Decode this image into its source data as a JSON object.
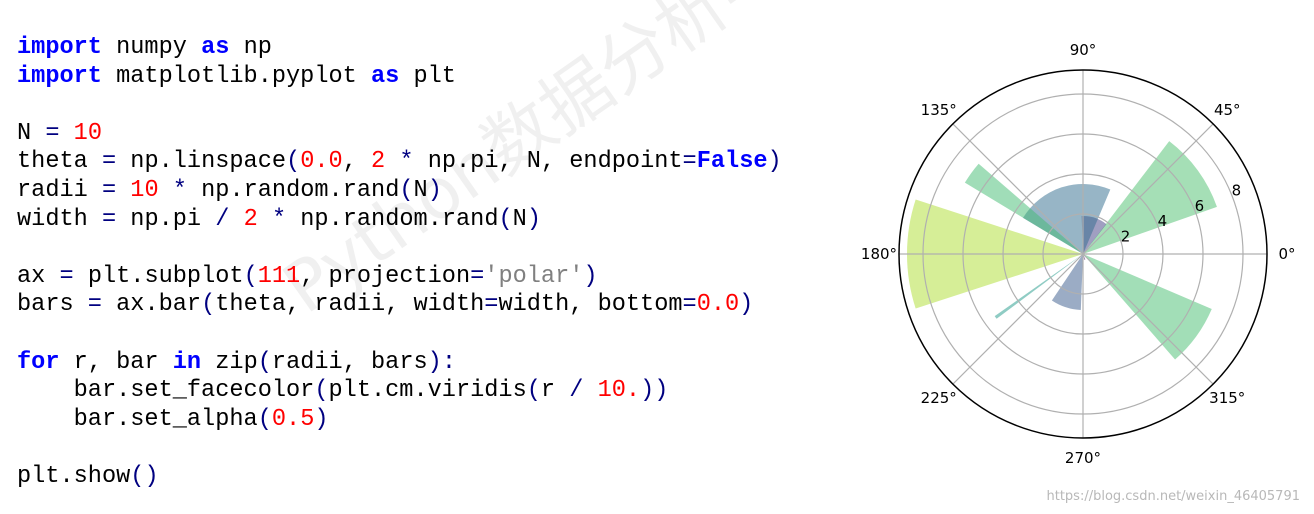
{
  "code": {
    "lines": [
      [
        [
          "kw",
          "import"
        ],
        [
          "plain",
          " numpy "
        ],
        [
          "kw",
          "as"
        ],
        [
          "plain",
          " np"
        ]
      ],
      [
        [
          "kw",
          "import"
        ],
        [
          "plain",
          " matplotlib.pyplot "
        ],
        [
          "kw",
          "as"
        ],
        [
          "plain",
          " plt"
        ]
      ],
      [],
      [
        [
          "plain",
          "N "
        ],
        [
          "op",
          "="
        ],
        [
          "plain",
          " "
        ],
        [
          "num",
          "10"
        ]
      ],
      [
        [
          "plain",
          "theta "
        ],
        [
          "op",
          "="
        ],
        [
          "plain",
          " np.linspace"
        ],
        [
          "op",
          "("
        ],
        [
          "num",
          "0.0"
        ],
        [
          "plain",
          ", "
        ],
        [
          "num",
          "2"
        ],
        [
          "plain",
          " "
        ],
        [
          "op",
          "*"
        ],
        [
          "plain",
          " np.pi, N, endpoint"
        ],
        [
          "op",
          "="
        ],
        [
          "const",
          "False"
        ],
        [
          "op",
          ")"
        ]
      ],
      [
        [
          "plain",
          "radii "
        ],
        [
          "op",
          "="
        ],
        [
          "plain",
          " "
        ],
        [
          "num",
          "10"
        ],
        [
          "plain",
          " "
        ],
        [
          "op",
          "*"
        ],
        [
          "plain",
          " np.random.rand"
        ],
        [
          "op",
          "("
        ],
        [
          "plain",
          "N"
        ],
        [
          "op",
          ")"
        ]
      ],
      [
        [
          "plain",
          "width "
        ],
        [
          "op",
          "="
        ],
        [
          "plain",
          " np.pi "
        ],
        [
          "op",
          "/"
        ],
        [
          "plain",
          " "
        ],
        [
          "num",
          "2"
        ],
        [
          "plain",
          " "
        ],
        [
          "op",
          "*"
        ],
        [
          "plain",
          " np.random.rand"
        ],
        [
          "op",
          "("
        ],
        [
          "plain",
          "N"
        ],
        [
          "op",
          ")"
        ]
      ],
      [],
      [
        [
          "plain",
          "ax "
        ],
        [
          "op",
          "="
        ],
        [
          "plain",
          " plt.subplot"
        ],
        [
          "op",
          "("
        ],
        [
          "num",
          "111"
        ],
        [
          "plain",
          ", projection"
        ],
        [
          "op",
          "="
        ],
        [
          "str",
          "'polar'"
        ],
        [
          "op",
          ")"
        ]
      ],
      [
        [
          "plain",
          "bars "
        ],
        [
          "op",
          "="
        ],
        [
          "plain",
          " ax.bar"
        ],
        [
          "op",
          "("
        ],
        [
          "plain",
          "theta, radii, width"
        ],
        [
          "op",
          "="
        ],
        [
          "plain",
          "width, bottom"
        ],
        [
          "op",
          "="
        ],
        [
          "num",
          "0.0"
        ],
        [
          "op",
          ")"
        ]
      ],
      [],
      [
        [
          "kw",
          "for"
        ],
        [
          "plain",
          " r, bar "
        ],
        [
          "kw",
          "in"
        ],
        [
          "plain",
          " zip"
        ],
        [
          "op",
          "("
        ],
        [
          "plain",
          "radii, bars"
        ],
        [
          "op",
          "):"
        ]
      ],
      [
        [
          "plain",
          "    bar.set_facecolor"
        ],
        [
          "op",
          "("
        ],
        [
          "plain",
          "plt.cm.viridis"
        ],
        [
          "op",
          "("
        ],
        [
          "plain",
          "r "
        ],
        [
          "op",
          "/"
        ],
        [
          "plain",
          " "
        ],
        [
          "num",
          "10."
        ],
        [
          "op",
          "))"
        ]
      ],
      [
        [
          "plain",
          "    bar.set_alpha"
        ],
        [
          "op",
          "("
        ],
        [
          "num",
          "0.5"
        ],
        [
          "op",
          ")"
        ]
      ],
      [],
      [
        [
          "plain",
          "plt.show"
        ],
        [
          "op",
          "()"
        ]
      ]
    ]
  },
  "watermark": "Python数据分析与展示",
  "source_url": "https://blog.csdn.net/weixin_46405791",
  "chart_data": {
    "type": "bar",
    "projection": "polar",
    "colormap": "viridis",
    "alpha": 0.5,
    "theta_deg": [
      0,
      36,
      72,
      108,
      144,
      180,
      216,
      252,
      288,
      324
    ],
    "radii": [
      0.2,
      7.1,
      1.9,
      3.5,
      6.9,
      8.8,
      5.4,
      2.8,
      0.3,
      7.0
    ],
    "width_rad": [
      0.3,
      0.58,
      0.7,
      1.43,
      0.17,
      0.63,
      0.03,
      0.55,
      0.2,
      0.45
    ],
    "rlim": [
      0,
      9.2
    ],
    "theta_ticks": [
      "0°",
      "45°",
      "90°",
      "135°",
      "180°",
      "225°",
      "270°",
      "315°"
    ],
    "r_ticks": [
      "2",
      "4",
      "6",
      "8"
    ],
    "grid": true
  }
}
